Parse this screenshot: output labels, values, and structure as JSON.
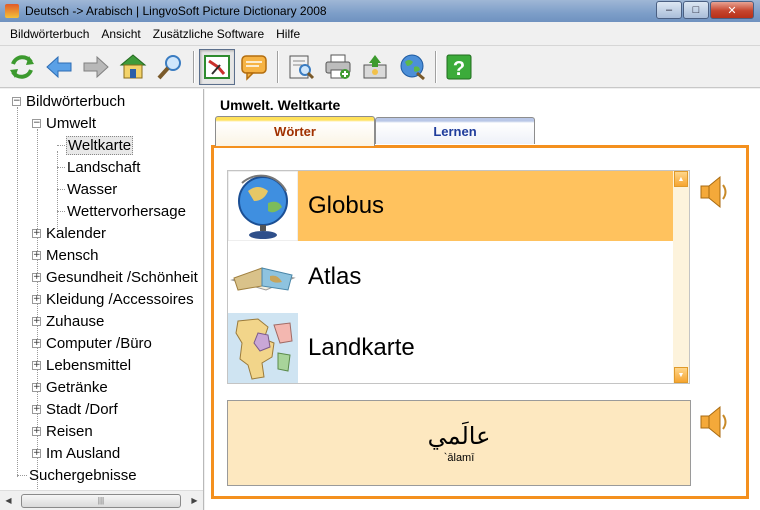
{
  "window": {
    "title": "Deutsch -> Arabisch | LingvoSoft Picture Dictionary 2008",
    "minimize": "–",
    "maximize": "□",
    "close": "✕"
  },
  "menu": [
    "Bildwörterbuch",
    "Ansicht",
    "Zusätzliche Software",
    "Hilfe"
  ],
  "toolbar_icons": [
    "refresh-icon",
    "back-arrow-icon",
    "forward-arrow-icon",
    "home-icon",
    "search-icon",
    "picture-mode-icon",
    "speech-bubble-icon",
    "book-search-icon",
    "printer-add-icon",
    "user-add-icon",
    "globe-search-icon",
    "help-icon"
  ],
  "tree": {
    "root": "Bildwörterbuch",
    "umwelt": "Umwelt",
    "umwelt_children": [
      "Weltkarte",
      "Landschaft",
      "Wasser",
      "Wettervorhersage"
    ],
    "categories": [
      "Kalender",
      "Mensch",
      "Gesundheit /Schönheit",
      "Kleidung /Accessoires",
      "Zuhause",
      "Computer /Büro",
      "Lebensmittel",
      "Getränke",
      "Stadt /Dorf",
      "Reisen",
      "Im Ausland"
    ],
    "search_results": "Suchergebnisse",
    "selected": "Weltkarte"
  },
  "main": {
    "title": "Umwelt. Weltkarte",
    "tabs": [
      {
        "label": "Wörter",
        "active": true
      },
      {
        "label": "Lernen",
        "active": false
      }
    ],
    "words": [
      {
        "word": "Globus",
        "selected": true,
        "icon": "globe-picture"
      },
      {
        "word": "Atlas",
        "selected": false,
        "icon": "atlas-picture"
      },
      {
        "word": "Landkarte",
        "selected": false,
        "icon": "map-picture"
      }
    ],
    "translation": {
      "arabic": "عالَمي",
      "transliteration": "`ālamī"
    }
  },
  "colors": {
    "accent_orange": "#f4901e",
    "selected_row": "#ffc25e",
    "translation_bg": "#fde8c0"
  }
}
